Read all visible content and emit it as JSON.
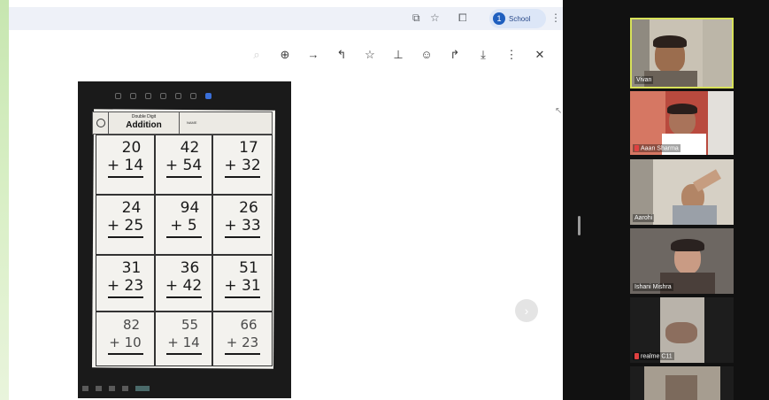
{
  "browser": {
    "profile_initial": "1",
    "profile_label": "School"
  },
  "toolbar": {
    "icons": [
      "zoom-out-icon",
      "zoom-in-icon",
      "forward-icon",
      "undo-icon",
      "star-icon",
      "pin-icon",
      "emoji-icon",
      "redo-icon",
      "download-icon",
      "more-icon",
      "close-icon"
    ]
  },
  "worksheet": {
    "title_small": "Double Digit",
    "title_big": "Addition",
    "name_label": "NAME",
    "problems": [
      {
        "top": "20",
        "bottom": "+ 14"
      },
      {
        "top": "42",
        "bottom": "+ 54"
      },
      {
        "top": "17",
        "bottom": "+ 32"
      },
      {
        "top": "24",
        "bottom": "+ 25"
      },
      {
        "top": "94",
        "bottom": "+ 5"
      },
      {
        "top": "26",
        "bottom": "+ 33"
      },
      {
        "top": "31",
        "bottom": "+ 23"
      },
      {
        "top": "36",
        "bottom": "+ 42"
      },
      {
        "top": "51",
        "bottom": "+ 31"
      },
      {
        "top": "82",
        "bottom": "+ 10"
      },
      {
        "top": "55",
        "bottom": "+ 14"
      },
      {
        "top": "66",
        "bottom": "+ 23"
      }
    ]
  },
  "participants": [
    {
      "name": "Vivan"
    },
    {
      "name": "Aaan Sharma"
    },
    {
      "name": "Aarohi"
    },
    {
      "name": "Ishani Mishra"
    },
    {
      "name": "realme C11"
    }
  ]
}
